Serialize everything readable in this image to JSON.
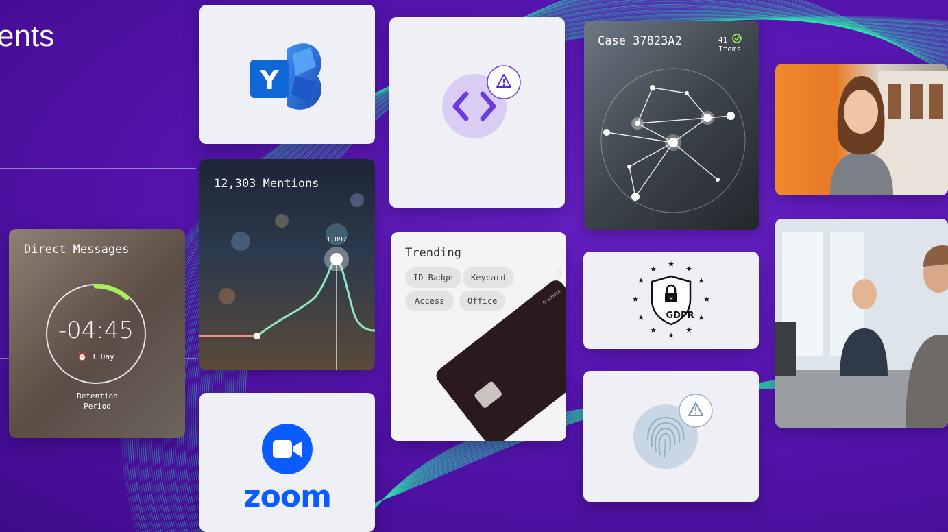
{
  "page": {
    "title_fragment": "ents"
  },
  "cards": {
    "direct_messages": {
      "label": "Direct Messages",
      "timer": "-04:45",
      "duration": "1 Day",
      "retention_line1": "Retention",
      "retention_line2": "Period"
    },
    "mentions": {
      "label": "12,303 Mentions",
      "peak_value": "1,097"
    },
    "zoom": {
      "wordmark": "zoom"
    },
    "yammer": {
      "letter": "Y"
    },
    "trending": {
      "label": "Trending",
      "chips": [
        "ID Badge",
        "Keycard",
        "Access",
        "Office"
      ],
      "card_text": "Business"
    },
    "case": {
      "label": "Case 37823A2",
      "count": "41",
      "count_unit": "Items"
    },
    "gdpr": {
      "label": "GDPR"
    }
  },
  "colors": {
    "background": "#5a17b4",
    "wave": "#2ee6b0",
    "zoom_blue": "#0b5cff",
    "accent_purple": "#6a3be0",
    "timer_green": "#a6f05a"
  },
  "icons": {
    "yammer": "yammer-logo-icon",
    "code": "code-brackets-icon",
    "warning": "warning-triangle-icon",
    "fingerprint": "fingerprint-icon",
    "clock": "alarm-clock-icon",
    "check": "check-circle-icon",
    "contactless": "contactless-icon",
    "gdpr": "gdpr-shield-lock-icon"
  }
}
